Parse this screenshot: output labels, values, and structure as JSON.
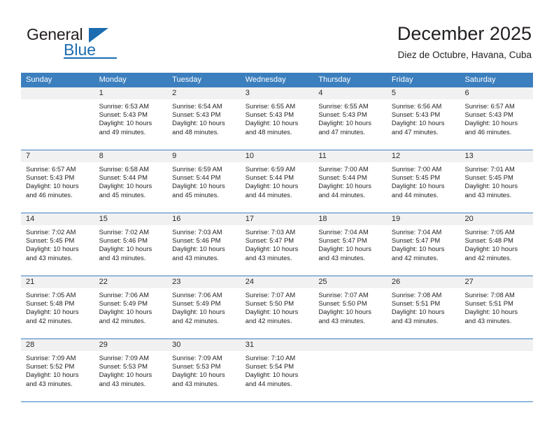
{
  "brand": {
    "name_top": "General",
    "name_bottom": "Blue",
    "triangle_icon": "triangle-icon",
    "accent_color": "#1b6cb0"
  },
  "header": {
    "month_title": "December 2025",
    "location": "Diez de Octubre, Havana, Cuba"
  },
  "calendar": {
    "header_color": "#3c7fbe",
    "daynum_band_color": "#f1f1f1",
    "weekdays": [
      "Sunday",
      "Monday",
      "Tuesday",
      "Wednesday",
      "Thursday",
      "Friday",
      "Saturday"
    ],
    "weeks": [
      [
        {
          "day": "",
          "sunrise": "",
          "sunset": "",
          "daylight_line1": "",
          "daylight_line2": ""
        },
        {
          "day": "1",
          "sunrise": "Sunrise: 6:53 AM",
          "sunset": "Sunset: 5:43 PM",
          "daylight_line1": "Daylight: 10 hours",
          "daylight_line2": "and 49 minutes."
        },
        {
          "day": "2",
          "sunrise": "Sunrise: 6:54 AM",
          "sunset": "Sunset: 5:43 PM",
          "daylight_line1": "Daylight: 10 hours",
          "daylight_line2": "and 48 minutes."
        },
        {
          "day": "3",
          "sunrise": "Sunrise: 6:55 AM",
          "sunset": "Sunset: 5:43 PM",
          "daylight_line1": "Daylight: 10 hours",
          "daylight_line2": "and 48 minutes."
        },
        {
          "day": "4",
          "sunrise": "Sunrise: 6:55 AM",
          "sunset": "Sunset: 5:43 PM",
          "daylight_line1": "Daylight: 10 hours",
          "daylight_line2": "and 47 minutes."
        },
        {
          "day": "5",
          "sunrise": "Sunrise: 6:56 AM",
          "sunset": "Sunset: 5:43 PM",
          "daylight_line1": "Daylight: 10 hours",
          "daylight_line2": "and 47 minutes."
        },
        {
          "day": "6",
          "sunrise": "Sunrise: 6:57 AM",
          "sunset": "Sunset: 5:43 PM",
          "daylight_line1": "Daylight: 10 hours",
          "daylight_line2": "and 46 minutes."
        }
      ],
      [
        {
          "day": "7",
          "sunrise": "Sunrise: 6:57 AM",
          "sunset": "Sunset: 5:43 PM",
          "daylight_line1": "Daylight: 10 hours",
          "daylight_line2": "and 46 minutes."
        },
        {
          "day": "8",
          "sunrise": "Sunrise: 6:58 AM",
          "sunset": "Sunset: 5:44 PM",
          "daylight_line1": "Daylight: 10 hours",
          "daylight_line2": "and 45 minutes."
        },
        {
          "day": "9",
          "sunrise": "Sunrise: 6:59 AM",
          "sunset": "Sunset: 5:44 PM",
          "daylight_line1": "Daylight: 10 hours",
          "daylight_line2": "and 45 minutes."
        },
        {
          "day": "10",
          "sunrise": "Sunrise: 6:59 AM",
          "sunset": "Sunset: 5:44 PM",
          "daylight_line1": "Daylight: 10 hours",
          "daylight_line2": "and 44 minutes."
        },
        {
          "day": "11",
          "sunrise": "Sunrise: 7:00 AM",
          "sunset": "Sunset: 5:44 PM",
          "daylight_line1": "Daylight: 10 hours",
          "daylight_line2": "and 44 minutes."
        },
        {
          "day": "12",
          "sunrise": "Sunrise: 7:00 AM",
          "sunset": "Sunset: 5:45 PM",
          "daylight_line1": "Daylight: 10 hours",
          "daylight_line2": "and 44 minutes."
        },
        {
          "day": "13",
          "sunrise": "Sunrise: 7:01 AM",
          "sunset": "Sunset: 5:45 PM",
          "daylight_line1": "Daylight: 10 hours",
          "daylight_line2": "and 43 minutes."
        }
      ],
      [
        {
          "day": "14",
          "sunrise": "Sunrise: 7:02 AM",
          "sunset": "Sunset: 5:45 PM",
          "daylight_line1": "Daylight: 10 hours",
          "daylight_line2": "and 43 minutes."
        },
        {
          "day": "15",
          "sunrise": "Sunrise: 7:02 AM",
          "sunset": "Sunset: 5:46 PM",
          "daylight_line1": "Daylight: 10 hours",
          "daylight_line2": "and 43 minutes."
        },
        {
          "day": "16",
          "sunrise": "Sunrise: 7:03 AM",
          "sunset": "Sunset: 5:46 PM",
          "daylight_line1": "Daylight: 10 hours",
          "daylight_line2": "and 43 minutes."
        },
        {
          "day": "17",
          "sunrise": "Sunrise: 7:03 AM",
          "sunset": "Sunset: 5:47 PM",
          "daylight_line1": "Daylight: 10 hours",
          "daylight_line2": "and 43 minutes."
        },
        {
          "day": "18",
          "sunrise": "Sunrise: 7:04 AM",
          "sunset": "Sunset: 5:47 PM",
          "daylight_line1": "Daylight: 10 hours",
          "daylight_line2": "and 43 minutes."
        },
        {
          "day": "19",
          "sunrise": "Sunrise: 7:04 AM",
          "sunset": "Sunset: 5:47 PM",
          "daylight_line1": "Daylight: 10 hours",
          "daylight_line2": "and 42 minutes."
        },
        {
          "day": "20",
          "sunrise": "Sunrise: 7:05 AM",
          "sunset": "Sunset: 5:48 PM",
          "daylight_line1": "Daylight: 10 hours",
          "daylight_line2": "and 42 minutes."
        }
      ],
      [
        {
          "day": "21",
          "sunrise": "Sunrise: 7:05 AM",
          "sunset": "Sunset: 5:48 PM",
          "daylight_line1": "Daylight: 10 hours",
          "daylight_line2": "and 42 minutes."
        },
        {
          "day": "22",
          "sunrise": "Sunrise: 7:06 AM",
          "sunset": "Sunset: 5:49 PM",
          "daylight_line1": "Daylight: 10 hours",
          "daylight_line2": "and 42 minutes."
        },
        {
          "day": "23",
          "sunrise": "Sunrise: 7:06 AM",
          "sunset": "Sunset: 5:49 PM",
          "daylight_line1": "Daylight: 10 hours",
          "daylight_line2": "and 42 minutes."
        },
        {
          "day": "24",
          "sunrise": "Sunrise: 7:07 AM",
          "sunset": "Sunset: 5:50 PM",
          "daylight_line1": "Daylight: 10 hours",
          "daylight_line2": "and 42 minutes."
        },
        {
          "day": "25",
          "sunrise": "Sunrise: 7:07 AM",
          "sunset": "Sunset: 5:50 PM",
          "daylight_line1": "Daylight: 10 hours",
          "daylight_line2": "and 43 minutes."
        },
        {
          "day": "26",
          "sunrise": "Sunrise: 7:08 AM",
          "sunset": "Sunset: 5:51 PM",
          "daylight_line1": "Daylight: 10 hours",
          "daylight_line2": "and 43 minutes."
        },
        {
          "day": "27",
          "sunrise": "Sunrise: 7:08 AM",
          "sunset": "Sunset: 5:51 PM",
          "daylight_line1": "Daylight: 10 hours",
          "daylight_line2": "and 43 minutes."
        }
      ],
      [
        {
          "day": "28",
          "sunrise": "Sunrise: 7:09 AM",
          "sunset": "Sunset: 5:52 PM",
          "daylight_line1": "Daylight: 10 hours",
          "daylight_line2": "and 43 minutes."
        },
        {
          "day": "29",
          "sunrise": "Sunrise: 7:09 AM",
          "sunset": "Sunset: 5:53 PM",
          "daylight_line1": "Daylight: 10 hours",
          "daylight_line2": "and 43 minutes."
        },
        {
          "day": "30",
          "sunrise": "Sunrise: 7:09 AM",
          "sunset": "Sunset: 5:53 PM",
          "daylight_line1": "Daylight: 10 hours",
          "daylight_line2": "and 43 minutes."
        },
        {
          "day": "31",
          "sunrise": "Sunrise: 7:10 AM",
          "sunset": "Sunset: 5:54 PM",
          "daylight_line1": "Daylight: 10 hours",
          "daylight_line2": "and 44 minutes."
        },
        {
          "day": "",
          "sunrise": "",
          "sunset": "",
          "daylight_line1": "",
          "daylight_line2": ""
        },
        {
          "day": "",
          "sunrise": "",
          "sunset": "",
          "daylight_line1": "",
          "daylight_line2": ""
        },
        {
          "day": "",
          "sunrise": "",
          "sunset": "",
          "daylight_line1": "",
          "daylight_line2": ""
        }
      ]
    ]
  }
}
